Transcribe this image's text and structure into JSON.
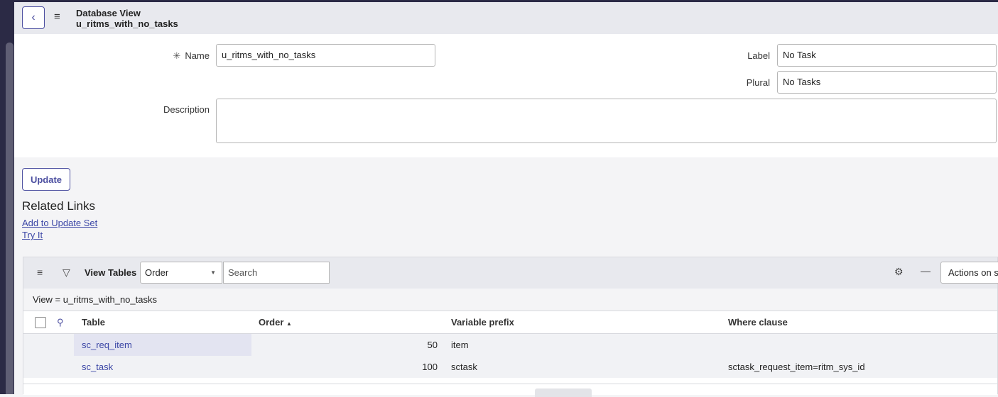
{
  "header": {
    "title": "Database View",
    "subtitle": "u_ritms_with_no_tasks"
  },
  "form": {
    "name_label": "Name",
    "name_value": "u_ritms_with_no_tasks",
    "required_mark": "✳",
    "label_label": "Label",
    "label_value": "No Task",
    "plural_label": "Plural",
    "plural_value": "No Tasks",
    "description_label": "Description",
    "description_value": ""
  },
  "update_button": "Update",
  "related_links": {
    "title": "Related Links",
    "links": [
      "Add to Update Set",
      "Try It"
    ]
  },
  "list": {
    "title": "View Tables",
    "sort_field": "Order",
    "search_placeholder": "Search",
    "actions_label": "Actions on selected rows",
    "breadcrumb": "View = u_ritms_with_no_tasks",
    "columns": [
      "Table",
      "Order",
      "Variable prefix",
      "Where clause"
    ],
    "sort_indicator": "▲",
    "rows": [
      {
        "table": "sc_req_item",
        "order": "50",
        "prefix": "item",
        "where": ""
      },
      {
        "table": "sc_task",
        "order": "100",
        "prefix": "sctask",
        "where": "sctask_request_item=ritm_sys_id"
      }
    ]
  }
}
